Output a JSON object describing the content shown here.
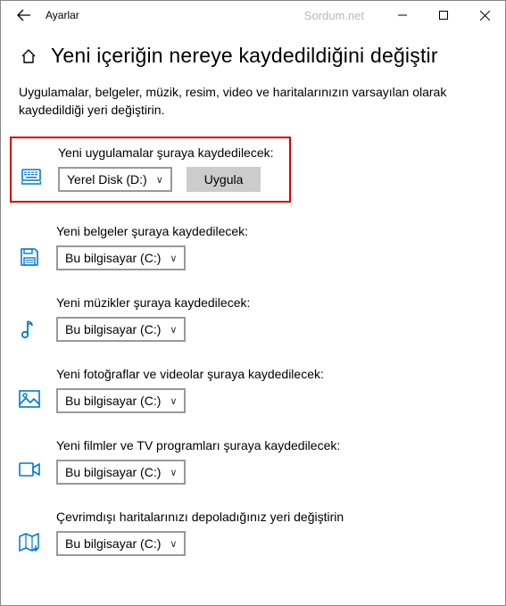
{
  "titlebar": {
    "title": "Ayarlar",
    "watermark": "Sordum.net"
  },
  "header": {
    "title": "Yeni içeriğin nereye kaydedildiğini değiştir"
  },
  "description": "Uygulamalar, belgeler, müzik, resim, video ve haritalarınızın varsayılan olarak kaydedildiği yeri değiştirin.",
  "apply_label": "Uygula",
  "rows": {
    "apps": {
      "label": "Yeni uygulamalar şuraya kaydedilecek:",
      "selected": "Yerel Disk (D:)"
    },
    "docs": {
      "label": "Yeni belgeler şuraya kaydedilecek:",
      "selected": "Bu bilgisayar (C:)"
    },
    "music": {
      "label": "Yeni müzikler şuraya kaydedilecek:",
      "selected": "Bu bilgisayar (C:)"
    },
    "photos": {
      "label": "Yeni fotoğraflar ve videolar şuraya kaydedilecek:",
      "selected": "Bu bilgisayar (C:)"
    },
    "movies": {
      "label": "Yeni filmler ve TV programları şuraya kaydedilecek:",
      "selected": "Bu bilgisayar (C:)"
    },
    "maps": {
      "label": "Çevrimdışı haritalarınızı depoladığınız yeri değiştirin",
      "selected": "Bu bilgisayar (C:)"
    }
  }
}
